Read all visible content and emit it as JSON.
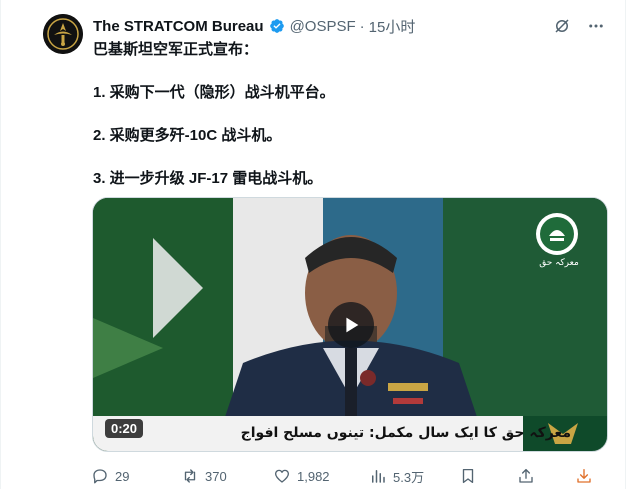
{
  "author": {
    "name": "The STRATCOM Bureau",
    "handle": "@OSPSF",
    "separator": "·",
    "time": "15小时"
  },
  "post": {
    "lines": [
      "巴基斯坦空军正式宣布：",
      "1. 采购下一代（隐形）战斗机平台。",
      "2. 采购更多歼-10C 战斗机。",
      "3. 进一步升级 JF-17 雷电战斗机。"
    ]
  },
  "video": {
    "duration": "0:20",
    "ticker": "معرکہ حق کا ایک سال مکمل: تینوں مسلح افواج کے اعلیٰ افسران کی میڈیا بریفنگ",
    "channel_caption": "معرکہ حق"
  },
  "stats": {
    "replies": "29",
    "reposts": "370",
    "likes": "1,982",
    "views": "5.3万"
  },
  "icons": {
    "verified": "verified-badge-icon",
    "grok": "grok-icon",
    "more": "more-icon",
    "reply": "reply-icon",
    "repost": "repost-icon",
    "like": "like-icon",
    "views": "views-icon",
    "bookmark": "bookmark-icon",
    "share": "share-icon",
    "download": "download-icon"
  },
  "colors": {
    "accent": "#1d9bf0",
    "text": "#0f1419",
    "muted": "#536471",
    "download": "#e0702a"
  }
}
